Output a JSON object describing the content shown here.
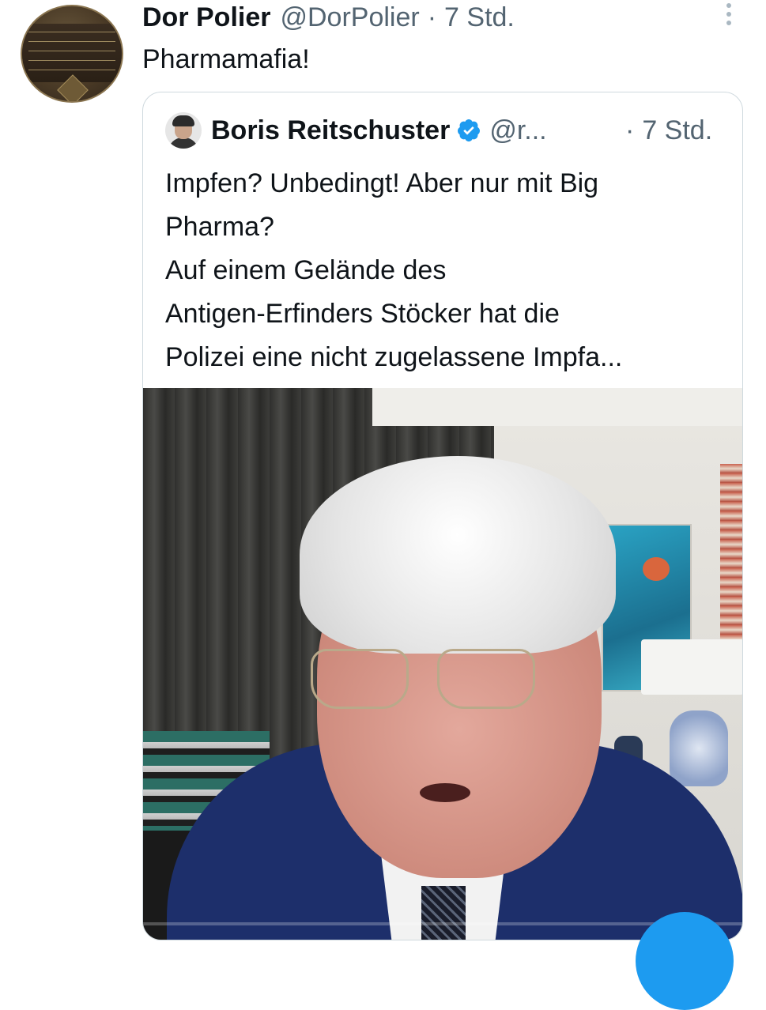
{
  "tweet": {
    "author_name": "Dor Polier",
    "author_handle": "@DorPolier",
    "separator": "·",
    "time": "7 Std.",
    "text": "Pharmamafia!"
  },
  "quoted_tweet": {
    "author_name": "Boris Reitschuster",
    "author_handle": "@r...",
    "separator": "·",
    "time": "7 Std.",
    "verified": true,
    "text_lines": [
      "Impfen? Unbedingt! Aber nur mit Big",
      "Pharma?",
      "Auf einem Gelände des",
      "Antigen-Erfinders Stöcker hat die",
      "Polizei eine nicht zugelassene Impfa..."
    ]
  },
  "icons": {
    "more": "more-vertical-icon",
    "verified": "verified-badge-icon",
    "compose": "compose-fab-icon"
  },
  "colors": {
    "link_blue": "#1d9bf0",
    "muted_text": "#536471",
    "border": "#cfd9de"
  }
}
